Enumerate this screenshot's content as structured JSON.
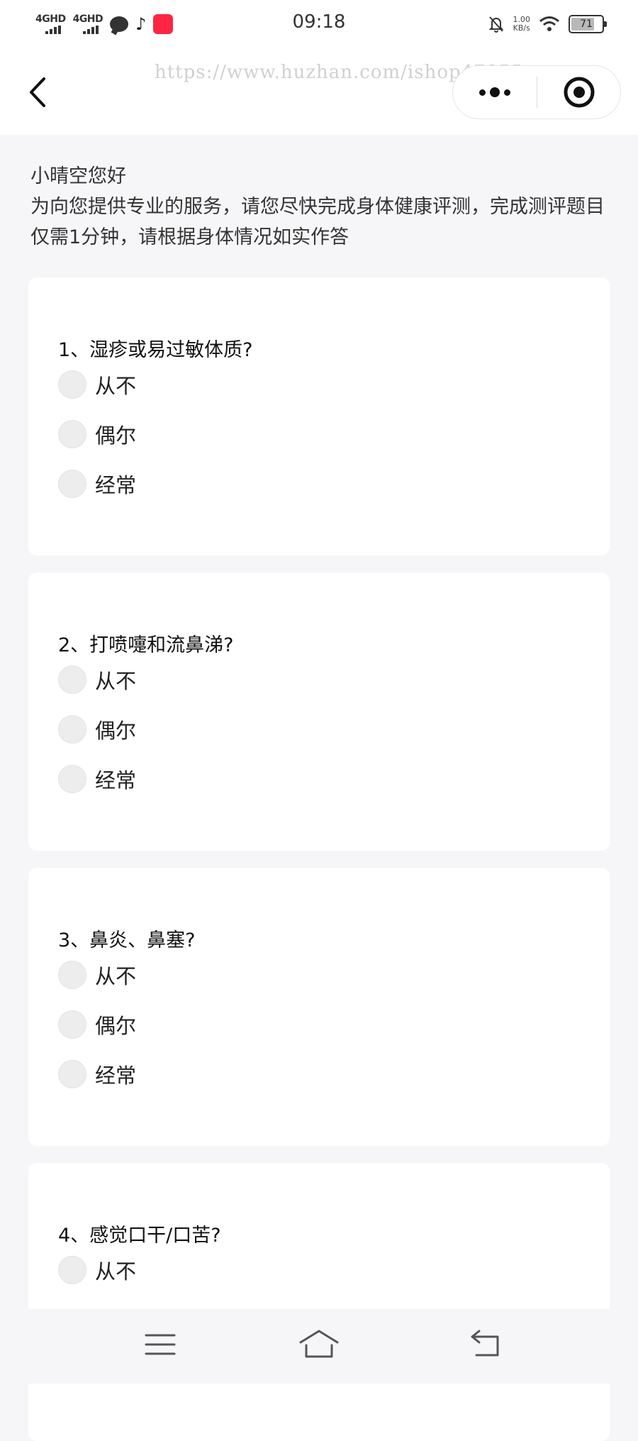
{
  "status_bar": {
    "network_1": "4GHD",
    "network_2": "4GHD",
    "app_icon_label": "小红书",
    "time": "09:18",
    "speed_value": "1.00",
    "speed_unit": "KB/s",
    "battery": "71"
  },
  "nav": {
    "watermark": "https://www.huzhan.com/ishop47855"
  },
  "intro": {
    "greeting": "小晴空您好",
    "instruction": "为向您提供专业的服务，请您尽快完成身体健康评测，完成测评题目仅需1分钟，请根据身体情况如实作答"
  },
  "questions": [
    {
      "title": "1、湿疹或易过敏体质?",
      "options": [
        "从不",
        "偶尔",
        "经常"
      ]
    },
    {
      "title": "2、打喷嚏和流鼻涕?",
      "options": [
        "从不",
        "偶尔",
        "经常"
      ]
    },
    {
      "title": "3、鼻炎、鼻塞?",
      "options": [
        "从不",
        "偶尔",
        "经常"
      ]
    },
    {
      "title": "4、感觉口干/口苦?",
      "options": [
        "从不"
      ]
    }
  ]
}
